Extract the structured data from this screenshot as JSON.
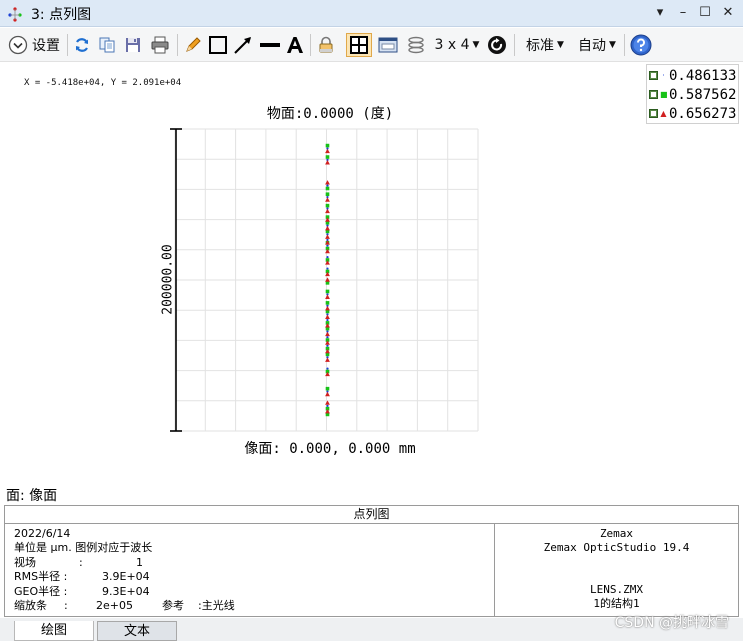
{
  "window": {
    "title": "3: 点列图",
    "controls": [
      "▾",
      "–",
      "☐",
      "✕"
    ]
  },
  "toolbar": {
    "settings_label": "设置",
    "layout_label": "3 x 4",
    "standard_label": "标准",
    "auto_label": "自动",
    "icons": [
      "refresh-icon",
      "copy-icon",
      "save-icon",
      "print-icon",
      "pencil-icon",
      "rectangle-icon",
      "arrow-icon",
      "line-icon",
      "text-icon",
      "lock-icon",
      "grid-icon",
      "window-icon",
      "layers-icon",
      "layout-icon",
      "rotate-icon",
      "help-icon"
    ]
  },
  "cursor_readout": "X = -5.418e+04, Y = 2.091e+04",
  "legend": {
    "items": [
      {
        "value": "0.486133",
        "color": "#1a3fd6",
        "marker": "·"
      },
      {
        "value": "0.587562",
        "color": "#17c217",
        "marker": "■"
      },
      {
        "value": "0.656273",
        "color": "#d12020",
        "marker": "▲"
      }
    ]
  },
  "plot": {
    "title": "物面:0.0000 (度)",
    "subtitle": "像面: 0.000, 0.000 mm",
    "scale_label": "200000.00"
  },
  "chart_data": {
    "type": "scatter",
    "title": "物面:0.0000 (度)",
    "xlabel": "像面: 0.000, 0.000 mm",
    "ylabel": "200000.00",
    "grid": true,
    "grid_divisions": [
      10,
      10
    ],
    "series": [
      {
        "name": "0.486133",
        "color": "#1a3fd6",
        "x": 0,
        "y_fraction": [
          0.04,
          0.08,
          0.17,
          0.21,
          0.25,
          0.29,
          0.31,
          0.34,
          0.36,
          0.38,
          0.42,
          0.46,
          0.5,
          0.55,
          0.59,
          0.62,
          0.64,
          0.68,
          0.7,
          0.73,
          0.77,
          0.81,
          0.89,
          0.94,
          0.96
        ]
      },
      {
        "name": "0.587562",
        "color": "#17c217",
        "x": 0,
        "y_fraction": [
          0.03,
          0.07,
          0.18,
          0.2,
          0.24,
          0.28,
          0.3,
          0.33,
          0.37,
          0.39,
          0.43,
          0.47,
          0.51,
          0.54,
          0.58,
          0.61,
          0.65,
          0.67,
          0.71,
          0.74,
          0.76,
          0.82,
          0.88,
          0.95,
          0.97
        ]
      },
      {
        "name": "0.656273",
        "color": "#d12020",
        "x": 0,
        "y_fraction": [
          0.05,
          0.09,
          0.16,
          0.22,
          0.26,
          0.29,
          0.32,
          0.35,
          0.37,
          0.4,
          0.44,
          0.48,
          0.5,
          0.56,
          0.6,
          0.63,
          0.66,
          0.69,
          0.72,
          0.75,
          0.78,
          0.83,
          0.9,
          0.93,
          0.96
        ]
      }
    ]
  },
  "surface_label": "面: 像面",
  "info": {
    "header": "点列图",
    "date": "2022/6/14",
    "units_line": "单位是 µm. 图例对应于波长",
    "field_label": "视场",
    "field_colon": ":",
    "field_value": "1",
    "rms_label": "RMS半径 :",
    "rms_value": "3.9E+04",
    "geo_label": "GEO半径 :",
    "geo_value": "9.3E+04",
    "scale_bar_label": "缩放条",
    "scale_bar_colon": ":",
    "scale_bar_value": "2e+05",
    "reference_label": "参考",
    "reference_value": ":主光线",
    "vendor": "Zemax",
    "product": "Zemax OpticStudio 19.4",
    "file": "LENS.ZMX",
    "config": "1的结构1"
  },
  "tabs": [
    {
      "label": "绘图"
    },
    {
      "label": "文本"
    }
  ],
  "watermark": "CSDN @挑畔冰雪"
}
